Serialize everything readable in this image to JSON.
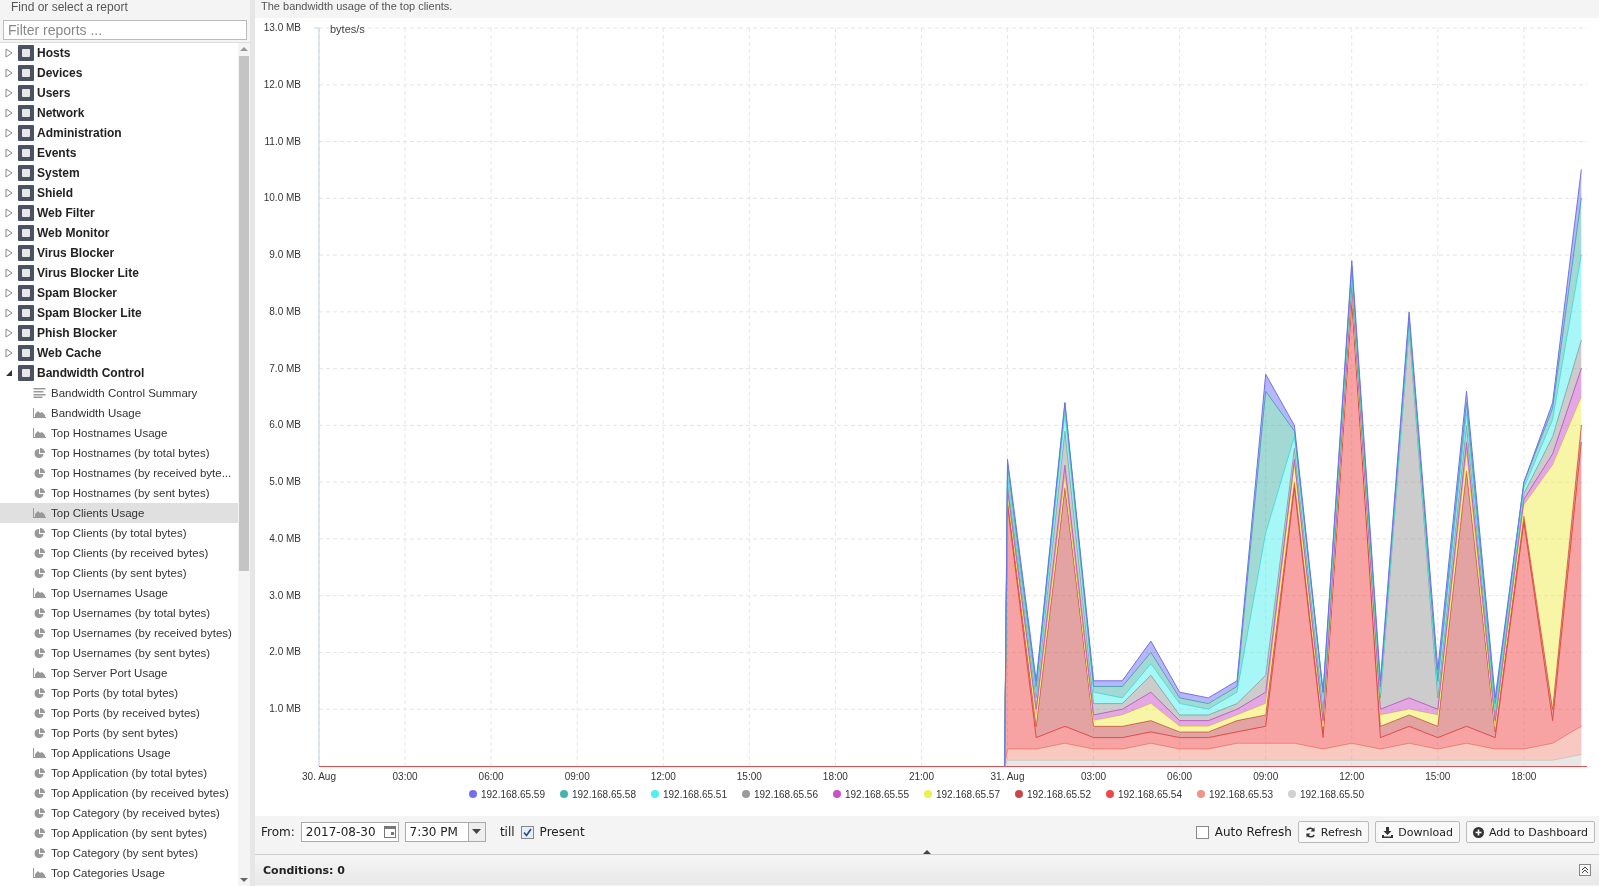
{
  "sidebar": {
    "title": "Find or select a report",
    "filter": {
      "placeholder": "Filter reports ..."
    },
    "items": [
      {
        "label": "Hosts",
        "expanded": false,
        "selected": false
      },
      {
        "label": "Devices",
        "expanded": false,
        "selected": false
      },
      {
        "label": "Users",
        "expanded": false,
        "selected": false
      },
      {
        "label": "Network",
        "expanded": false,
        "selected": false
      },
      {
        "label": "Administration",
        "expanded": false,
        "selected": false
      },
      {
        "label": "Events",
        "expanded": false,
        "selected": false
      },
      {
        "label": "System",
        "expanded": false,
        "selected": false
      },
      {
        "label": "Shield",
        "expanded": false,
        "selected": false
      },
      {
        "label": "Web Filter",
        "expanded": false,
        "selected": false
      },
      {
        "label": "Web Monitor",
        "expanded": false,
        "selected": false
      },
      {
        "label": "Virus Blocker",
        "expanded": false,
        "selected": false
      },
      {
        "label": "Virus Blocker Lite",
        "expanded": false,
        "selected": false
      },
      {
        "label": "Spam Blocker",
        "expanded": false,
        "selected": false
      },
      {
        "label": "Spam Blocker Lite",
        "expanded": false,
        "selected": false
      },
      {
        "label": "Phish Blocker",
        "expanded": false,
        "selected": false
      },
      {
        "label": "Web Cache",
        "expanded": false,
        "selected": false
      },
      {
        "label": "Bandwidth Control",
        "expanded": true,
        "selected": false,
        "children": [
          {
            "label": "Bandwidth Control Summary",
            "kind": "summary",
            "selected": false
          },
          {
            "label": "Bandwidth Usage",
            "kind": "area",
            "selected": false
          },
          {
            "label": "Top Hostnames Usage",
            "kind": "area",
            "selected": false
          },
          {
            "label": "Top Hostnames (by total bytes)",
            "kind": "pie",
            "selected": false
          },
          {
            "label": "Top Hostnames (by received byte...",
            "kind": "pie",
            "selected": false
          },
          {
            "label": "Top Hostnames (by sent bytes)",
            "kind": "pie",
            "selected": false
          },
          {
            "label": "Top Clients Usage",
            "kind": "area",
            "selected": true
          },
          {
            "label": "Top Clients (by total bytes)",
            "kind": "pie",
            "selected": false
          },
          {
            "label": "Top Clients (by received bytes)",
            "kind": "pie",
            "selected": false
          },
          {
            "label": "Top Clients (by sent bytes)",
            "kind": "pie",
            "selected": false
          },
          {
            "label": "Top Usernames Usage",
            "kind": "area",
            "selected": false
          },
          {
            "label": "Top Usernames (by total bytes)",
            "kind": "pie",
            "selected": false
          },
          {
            "label": "Top Usernames (by received bytes)",
            "kind": "pie",
            "selected": false
          },
          {
            "label": "Top Usernames (by sent bytes)",
            "kind": "pie",
            "selected": false
          },
          {
            "label": "Top Server Port Usage",
            "kind": "area",
            "selected": false
          },
          {
            "label": "Top Ports (by total bytes)",
            "kind": "pie",
            "selected": false
          },
          {
            "label": "Top Ports (by received bytes)",
            "kind": "pie",
            "selected": false
          },
          {
            "label": "Top Ports (by sent bytes)",
            "kind": "pie",
            "selected": false
          },
          {
            "label": "Top Applications Usage",
            "kind": "area",
            "selected": false
          },
          {
            "label": "Top Application (by total bytes)",
            "kind": "pie",
            "selected": false
          },
          {
            "label": "Top Application (by received bytes)",
            "kind": "pie",
            "selected": false
          },
          {
            "label": "Top Category (by received bytes)",
            "kind": "pie",
            "selected": false
          },
          {
            "label": "Top Application (by sent bytes)",
            "kind": "pie",
            "selected": false
          },
          {
            "label": "Top Category (by sent bytes)",
            "kind": "pie",
            "selected": false
          },
          {
            "label": "Top Categories Usage",
            "kind": "area",
            "selected": false
          }
        ]
      }
    ]
  },
  "report": {
    "description": "The bandwidth usage of the top clients.",
    "chart_data": {
      "type": "area",
      "stacked": true,
      "ylabel": "bytes/s",
      "grid": true,
      "legend": true,
      "x": [
        "2017-08-30T23:54",
        "2017-08-31T00:00",
        "2017-08-31T01:00",
        "2017-08-31T02:00",
        "2017-08-31T03:00",
        "2017-08-31T04:00",
        "2017-08-31T05:00",
        "2017-08-31T06:00",
        "2017-08-31T07:00",
        "2017-08-31T08:00",
        "2017-08-31T09:00",
        "2017-08-31T10:00",
        "2017-08-31T11:00",
        "2017-08-31T12:00",
        "2017-08-31T13:00",
        "2017-08-31T14:00",
        "2017-08-31T15:00",
        "2017-08-31T16:00",
        "2017-08-31T17:00",
        "2017-08-31T18:00",
        "2017-08-31T19:00",
        "2017-08-31T20:00"
      ],
      "xlim": [
        "2017-08-30T00:00",
        "2017-08-31T20:12"
      ],
      "ylim": [
        0,
        13
      ],
      "xticks": [
        {
          "value": "2017-08-30T00:00",
          "label": "30. Aug"
        },
        {
          "value": "2017-08-30T03:00",
          "label": "03:00"
        },
        {
          "value": "2017-08-30T06:00",
          "label": "06:00"
        },
        {
          "value": "2017-08-30T09:00",
          "label": "09:00"
        },
        {
          "value": "2017-08-30T12:00",
          "label": "12:00"
        },
        {
          "value": "2017-08-30T15:00",
          "label": "15:00"
        },
        {
          "value": "2017-08-30T18:00",
          "label": "18:00"
        },
        {
          "value": "2017-08-30T21:00",
          "label": "21:00"
        },
        {
          "value": "2017-08-31T00:00",
          "label": "31. Aug"
        },
        {
          "value": "2017-08-31T03:00",
          "label": "03:00"
        },
        {
          "value": "2017-08-31T06:00",
          "label": "06:00"
        },
        {
          "value": "2017-08-31T09:00",
          "label": "09:00"
        },
        {
          "value": "2017-08-31T12:00",
          "label": "12:00"
        },
        {
          "value": "2017-08-31T15:00",
          "label": "15:00"
        },
        {
          "value": "2017-08-31T18:00",
          "label": "18:00"
        }
      ],
      "yticks": [
        {
          "value": 1,
          "label": "1.0 MB"
        },
        {
          "value": 2,
          "label": "2.0 MB"
        },
        {
          "value": 3,
          "label": "3.0 MB"
        },
        {
          "value": 4,
          "label": "4.0 MB"
        },
        {
          "value": 5,
          "label": "5.0 MB"
        },
        {
          "value": 6,
          "label": "6.0 MB"
        },
        {
          "value": 7,
          "label": "7.0 MB"
        },
        {
          "value": 8,
          "label": "8.0 MB"
        },
        {
          "value": 9,
          "label": "9.0 MB"
        },
        {
          "value": 10,
          "label": "10.0 MB"
        },
        {
          "value": 11,
          "label": "11.0 MB"
        },
        {
          "value": 12,
          "label": "12.0 MB"
        },
        {
          "value": 13,
          "label": "13.0 MB"
        }
      ],
      "series": [
        {
          "name": "192.168.65.59",
          "color": "#7070f0",
          "values": [
            0,
            0.1,
            0.1,
            0.0,
            0.1,
            0.1,
            0.2,
            0.1,
            0.1,
            0.1,
            0.3,
            0.1,
            0.0,
            0.1,
            0.1,
            0.1,
            0.2,
            0.2,
            0.1,
            0.0,
            0.1,
            0.5
          ]
        },
        {
          "name": "192.168.65.58",
          "color": "#46b4aa",
          "values": [
            0,
            0.2,
            0.1,
            0.2,
            0.1,
            0.2,
            0.2,
            0.1,
            0.1,
            0.1,
            2.5,
            0.1,
            0.1,
            0.1,
            0.1,
            0.1,
            0.1,
            0.2,
            0.1,
            0.1,
            0.2,
            1.0
          ]
        },
        {
          "name": "192.168.65.51",
          "color": "#50f0f0",
          "values": [
            0,
            0.1,
            0.1,
            0.3,
            0.2,
            0.1,
            0.2,
            0.2,
            0.1,
            0.2,
            2.5,
            0.2,
            0.2,
            0.1,
            0.1,
            0.1,
            0.2,
            0.2,
            0.1,
            0.1,
            0.3,
            1.5
          ]
        },
        {
          "name": "192.168.65.56",
          "color": "#9a9a9a",
          "values": [
            0,
            0.1,
            0.2,
            0.6,
            0.2,
            0.1,
            0.3,
            0.1,
            0.1,
            0.1,
            0.3,
            0.2,
            0.2,
            0.1,
            0.2,
            6.5,
            0.2,
            0.3,
            0.1,
            0.1,
            0.3,
            0.5
          ]
        },
        {
          "name": "192.168.65.55",
          "color": "#c850c8",
          "values": [
            0,
            0.1,
            0.1,
            0.2,
            0.1,
            0.1,
            0.2,
            0.1,
            0.1,
            0.1,
            0.2,
            0.1,
            0.1,
            0.1,
            0.1,
            0.2,
            0.1,
            0.2,
            0.1,
            0.1,
            0.2,
            0.5
          ]
        },
        {
          "name": "192.168.65.57",
          "color": "#f0ee50",
          "values": [
            0,
            0.1,
            0.2,
            0.2,
            0.1,
            0.2,
            0.3,
            0.1,
            0.1,
            0.1,
            0.2,
            0.3,
            0.1,
            0.1,
            0.2,
            0.1,
            0.2,
            0.3,
            0.1,
            0.2,
            4.3,
            0.5
          ]
        },
        {
          "name": "192.168.65.52",
          "color": "#c84848",
          "values": [
            0,
            0.1,
            0.2,
            4.2,
            0.2,
            0.2,
            0.2,
            0.1,
            0.1,
            0.2,
            0.2,
            0.1,
            0.1,
            0.1,
            0.2,
            0.2,
            0.2,
            4.5,
            0.1,
            0.1,
            0.2,
            0.3
          ]
        },
        {
          "name": "192.168.65.54",
          "color": "#f04848",
          "values": [
            0,
            4.3,
            0.2,
            0.3,
            0.2,
            0.2,
            0.2,
            0.2,
            0.2,
            0.2,
            0.3,
            4.5,
            0.2,
            7.8,
            0.2,
            0.3,
            0.2,
            0.3,
            0.2,
            4.0,
            0.4,
            5.0
          ]
        },
        {
          "name": "192.168.65.53",
          "color": "#f09484",
          "values": [
            0,
            0.2,
            0.2,
            0.3,
            0.2,
            0.2,
            0.3,
            0.2,
            0.2,
            0.3,
            0.3,
            0.3,
            0.2,
            0.3,
            0.2,
            0.3,
            0.2,
            0.3,
            0.2,
            0.2,
            0.3,
            0.5
          ]
        },
        {
          "name": "192.168.65.50",
          "color": "#d0d0d0",
          "values": [
            0,
            0.1,
            0.1,
            0.1,
            0.1,
            0.1,
            0.1,
            0.1,
            0.1,
            0.1,
            0.1,
            0.1,
            0.1,
            0.1,
            0.1,
            0.1,
            0.1,
            0.1,
            0.1,
            0.1,
            0.1,
            0.2
          ]
        }
      ]
    }
  },
  "toolbar": {
    "from_label": "From:",
    "date": "2017-08-30",
    "time": "7:30 PM",
    "till_label": "till",
    "present": {
      "label": "Present",
      "checked": true
    },
    "auto_refresh": {
      "label": "Auto Refresh",
      "checked": false
    },
    "buttons": [
      {
        "label": "Refresh",
        "kind": "refresh"
      },
      {
        "label": "Download",
        "kind": "download"
      },
      {
        "label": "Add to Dashboard",
        "kind": "add"
      }
    ]
  },
  "conditions": {
    "label": "Conditions: 0"
  }
}
